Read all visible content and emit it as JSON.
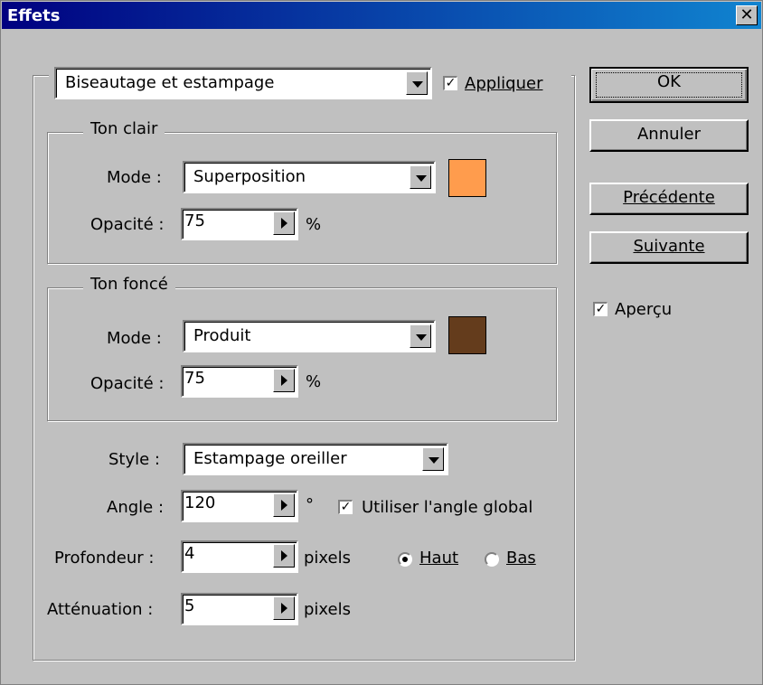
{
  "window": {
    "title": "Effets",
    "close_glyph": "✕"
  },
  "effect_select": {
    "value": "Biseautage et estampage"
  },
  "apply": {
    "label": "Appliquer",
    "checked": true
  },
  "highlight": {
    "legend": "Ton clair",
    "mode_label": "Mode :",
    "mode_value": "Superposition",
    "opacity_label": "Opacité :",
    "opacity_value": "75",
    "unit": "%",
    "color": "#ff9c4d"
  },
  "shadow": {
    "legend": "Ton foncé",
    "mode_label": "Mode :",
    "mode_value": "Produit",
    "opacity_label": "Opacité :",
    "opacity_value": "75",
    "unit": "%",
    "color": "#643c1c"
  },
  "style": {
    "label": "Style :",
    "value": "Estampage oreiller"
  },
  "angle": {
    "label": "Angle :",
    "value": "120",
    "unit": "°",
    "global_label": "Utiliser l'angle global",
    "global_checked": true
  },
  "depth": {
    "label": "Profondeur :",
    "value": "4",
    "unit": "pixels",
    "up_label": "Haut",
    "down_label": "Bas",
    "selected": "Haut"
  },
  "blur": {
    "label": "Atténuation :",
    "value": "5",
    "unit": "pixels"
  },
  "buttons": {
    "ok": "OK",
    "cancel": "Annuler",
    "previous": "Précédente",
    "next": "Suivante"
  },
  "preview": {
    "label": "Aperçu",
    "checked": true
  }
}
